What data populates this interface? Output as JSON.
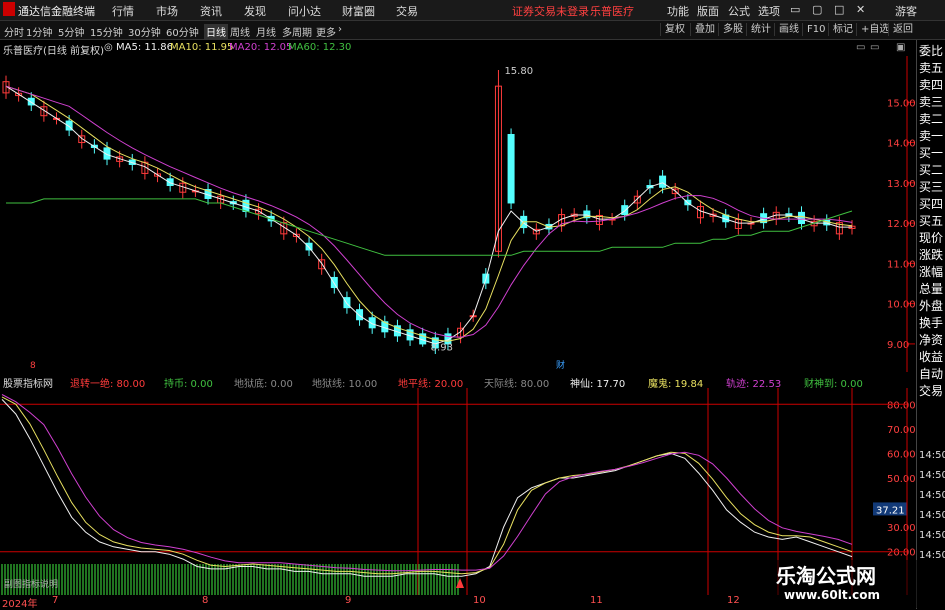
{
  "titlebar": {
    "app_name": "通达信金融终端",
    "menu": [
      "行情",
      "市场",
      "资讯",
      "发现",
      "问小达",
      "财富圈",
      "交易"
    ],
    "status": "证券交易未登录",
    "stock": "乐普医疗",
    "right": [
      "功能",
      "版面",
      "公式",
      "选项"
    ],
    "guest": "游客"
  },
  "periods": [
    "分时",
    "1分钟",
    "5分钟",
    "15分钟",
    "30分钟",
    "60分钟",
    "日线",
    "周线",
    "月线",
    "多周期",
    "更多"
  ],
  "selected_period": "日线",
  "toolbar_right": [
    "复权",
    "叠加",
    "多股",
    "统计",
    "画线",
    "F10",
    "标记",
    "+自选",
    "返回"
  ],
  "header": {
    "stock_title": "乐普医疗(日线 前复权)",
    "ma5": "MA5: 11.86",
    "ma10": "MA10: 11.95",
    "ma20": "MA20: 12.05",
    "ma60": "MA60: 12.30"
  },
  "colors": {
    "up": "#ff3b3b",
    "down": "#54ffff",
    "ma5": "#f0f0f0",
    "ma10": "#e8e060",
    "ma20": "#d040d0",
    "ma60": "#40c040",
    "ind_white": "#f0f0f0",
    "ind_yellow": "#e8e060",
    "ind_magenta": "#d040d0"
  },
  "price_axis": [
    "15.00",
    "14.00",
    "13.00",
    "12.00",
    "11.00",
    "10.00",
    "9.00"
  ],
  "price_max_label": "15.80",
  "price_min_label": "8.93",
  "right_panel": [
    "委比",
    "卖五",
    "卖四",
    "卖三",
    "卖二",
    "卖一",
    "买一",
    "买二",
    "买三",
    "买四",
    "买五",
    "现价",
    "涨跌",
    "涨幅",
    "总量",
    "外盘",
    "换手",
    "净资",
    "收益",
    "自动",
    "交易"
  ],
  "right_times": [
    "14:50",
    "14:50",
    "14:50",
    "14:50",
    "14:50",
    "14:50"
  ],
  "indicator": {
    "name": "股票指标网",
    "items": [
      {
        "label": "退转一绝:",
        "value": "80.00",
        "color": "#ff3b3b"
      },
      {
        "label": "持币:",
        "value": "0.00",
        "color": "#40c040"
      },
      {
        "label": "地狱底:",
        "value": "0.00",
        "color": "#888888"
      },
      {
        "label": "地狱线:",
        "value": "10.00",
        "color": "#888888"
      },
      {
        "label": "地平线:",
        "value": "20.00",
        "color": "#ff3b3b"
      },
      {
        "label": "天际线:",
        "value": "80.00",
        "color": "#888888"
      },
      {
        "label": "神仙:",
        "value": "17.70",
        "color": "#f0f0f0"
      },
      {
        "label": "魔鬼:",
        "value": "19.84",
        "color": "#e8e060"
      },
      {
        "label": "轨迹:",
        "value": "22.53",
        "color": "#d040d0"
      },
      {
        "label": "财神到:",
        "value": "0.00",
        "color": "#40c040"
      }
    ],
    "axis": [
      "80.00",
      "70.00",
      "60.00",
      "50.00",
      "37.21",
      "30.00",
      "20.00"
    ],
    "label_small": "副图指标说明"
  },
  "xaxis": [
    "2024年",
    "7",
    "8",
    "9",
    "10",
    "11",
    "12"
  ],
  "markers": {
    "left": "8",
    "right": "财"
  },
  "watermark": {
    "title": "乐淘公式网",
    "url": "www.60lt.com"
  },
  "chart_data": {
    "type": "candlestick",
    "y_range": [
      8.7,
      16.0
    ],
    "ma5": [
      15.4,
      15.2,
      15.0,
      14.8,
      14.6,
      14.4,
      14.1,
      13.9,
      13.7,
      13.6,
      13.5,
      13.4,
      13.2,
      13.0,
      12.9,
      12.8,
      12.7,
      12.6,
      12.5,
      12.4,
      12.3,
      12.1,
      11.9,
      11.7,
      11.4,
      11.0,
      10.5,
      10.0,
      9.7,
      9.5,
      9.4,
      9.3,
      9.2,
      9.1,
      9.0,
      9.1,
      9.3,
      9.7,
      10.6,
      11.8,
      12.3,
      12.0,
      11.8,
      11.9,
      12.1,
      12.2,
      12.2,
      12.1,
      12.1,
      12.3,
      12.6,
      12.9,
      13.0,
      12.8,
      12.5,
      12.3,
      12.2,
      12.1,
      12.0,
      12.0,
      12.1,
      12.2,
      12.2,
      12.1,
      12.0,
      12.0,
      11.9,
      11.9
    ],
    "ma60": [
      12.5,
      12.5,
      12.5,
      12.6,
      12.6,
      12.6,
      12.6,
      12.6,
      12.6,
      12.6,
      12.6,
      12.6,
      12.6,
      12.6,
      12.6,
      12.6,
      12.5,
      12.5,
      12.4,
      12.3,
      12.2,
      12.1,
      12.0,
      11.9,
      11.8,
      11.7,
      11.6,
      11.5,
      11.4,
      11.3,
      11.2,
      11.2,
      11.2,
      11.2,
      11.2,
      11.2,
      11.2,
      11.2,
      11.2,
      11.2,
      11.2,
      11.3,
      11.3,
      11.3,
      11.3,
      11.3,
      11.3,
      11.3,
      11.4,
      11.4,
      11.4,
      11.4,
      11.4,
      11.5,
      11.5,
      11.5,
      11.6,
      11.6,
      11.7,
      11.7,
      11.8,
      11.8,
      11.8,
      11.9,
      12.0,
      12.1,
      12.2,
      12.3
    ]
  }
}
